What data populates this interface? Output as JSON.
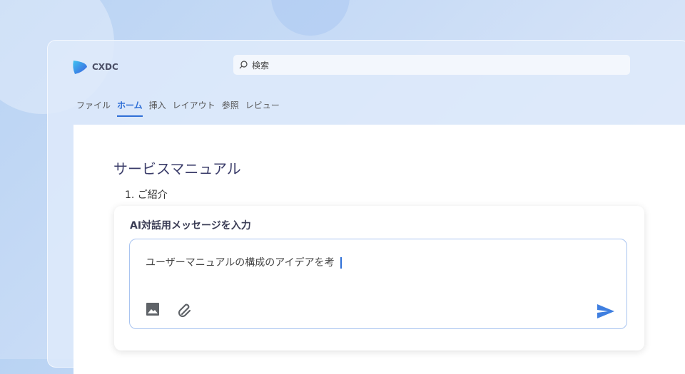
{
  "app": {
    "name": "CXDC"
  },
  "search": {
    "placeholder": "検索"
  },
  "tabs": [
    {
      "label": "ファイル"
    },
    {
      "label": "ホーム",
      "active": true
    },
    {
      "label": "挿入"
    },
    {
      "label": "レイアウト"
    },
    {
      "label": "参照"
    },
    {
      "label": "レビュー"
    }
  ],
  "document": {
    "title": "サービスマニュアル",
    "list": [
      "1. ご紹介"
    ]
  },
  "chat": {
    "title": "AI対話用メッセージを入力",
    "input_value": "ユーザーマニュアルの構成のアイデアを考"
  },
  "colors": {
    "accent": "#2f6fd6"
  }
}
